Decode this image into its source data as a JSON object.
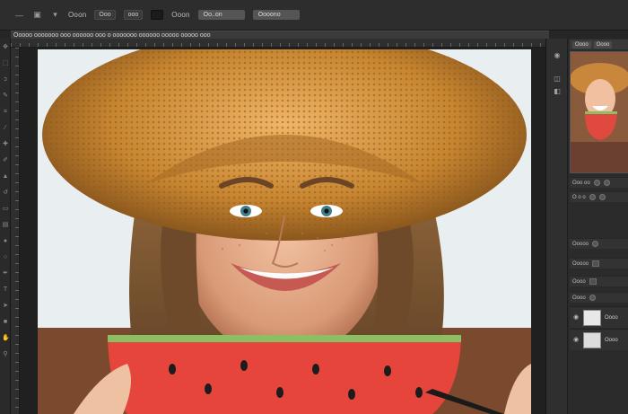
{
  "options_bar": {
    "items": [
      {
        "name": "Ooon",
        "kind": "label"
      },
      {
        "name": "Ooo",
        "kind": "chip"
      },
      {
        "name": "ooo",
        "kind": "chip"
      },
      {
        "name": "",
        "kind": "chip-dark"
      },
      {
        "name": "Ooon",
        "kind": "label"
      },
      {
        "name": "Oo..on",
        "kind": "field"
      },
      {
        "name": "Oooono",
        "kind": "field"
      }
    ]
  },
  "document": {
    "tab_label": "Ooooo ooooooo ooo oooooo ooo o ooooooo oooooo ooooo ooooo ooo"
  },
  "toolbar": {
    "tools": [
      "move-tool-icon",
      "marquee-tool-icon",
      "lasso-tool-icon",
      "quick-select-icon",
      "crop-tool-icon",
      "eyedropper-icon",
      "healing-brush-icon",
      "brush-tool-icon",
      "clone-stamp-icon",
      "history-brush-icon",
      "eraser-tool-icon",
      "gradient-tool-icon",
      "blur-tool-icon",
      "dodge-tool-icon",
      "pen-tool-icon",
      "type-tool-icon",
      "path-select-icon",
      "shape-tool-icon",
      "hand-tool-icon",
      "zoom-tool-icon"
    ]
  },
  "right_panel": {
    "header_tabs": [
      "Oooo",
      "Oooo"
    ],
    "rows": [
      {
        "label": "Ooo oo",
        "kind": "buttons"
      },
      {
        "label": "O o o",
        "kind": "buttons"
      },
      {
        "label": "Ooooo",
        "kind": "buttons"
      },
      {
        "label": "Ooooo",
        "kind": "buttons"
      },
      {
        "label": "Oooo",
        "kind": "buttons"
      },
      {
        "label": "Oooo",
        "kind": "buttons"
      }
    ],
    "layers": [
      {
        "name": "Oooo",
        "visible": true
      },
      {
        "name": "Oooo",
        "visible": true
      }
    ]
  },
  "canvas": {
    "content": "photo of smiling woman in straw hat holding watermelon slice"
  }
}
